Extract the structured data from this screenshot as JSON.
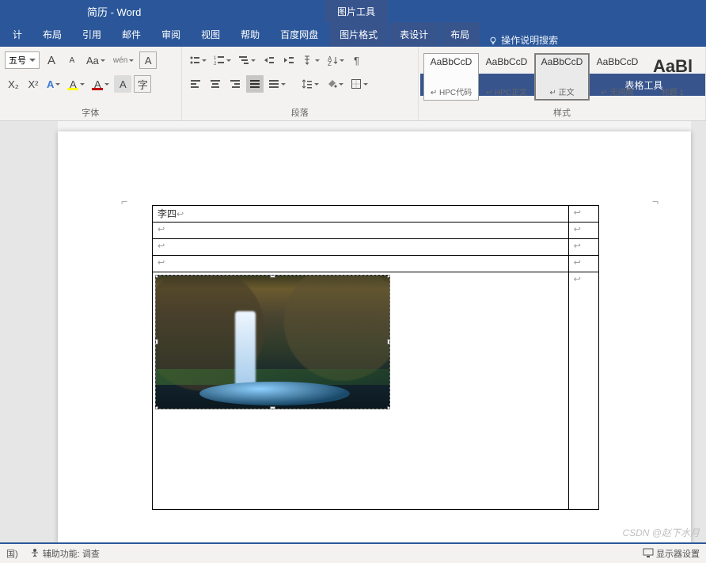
{
  "title": "简历 - Word",
  "contextual": {
    "picture": "图片工具",
    "table": "表格工具"
  },
  "menu": {
    "items": [
      "计",
      "布局",
      "引用",
      "邮件",
      "审阅",
      "视图",
      "帮助",
      "百度网盘"
    ],
    "ctx_items": [
      "图片格式",
      "表设计",
      "布局"
    ],
    "tell_me": "操作说明搜索"
  },
  "ribbon": {
    "font": {
      "size": "五号",
      "grow": "A",
      "shrink": "A",
      "case": "Aa",
      "phonetic": "wén",
      "charborder": "A",
      "sub": "X₂",
      "sup": "X²",
      "texteffects": "A",
      "highlight": "A",
      "fontcolor": "A",
      "charshade": "A",
      "enclose": "字",
      "highlight_color": "#ffff00",
      "fontcolor_color": "#c00000",
      "label": "字体"
    },
    "para": {
      "label": "段落"
    },
    "styles": {
      "label": "样式",
      "items": [
        {
          "preview": "AaBbCcD",
          "name": "HPC代码",
          "mark": "↵"
        },
        {
          "preview": "AaBbCcD",
          "name": "HPC正文",
          "mark": "↵"
        },
        {
          "preview": "AaBbCcD",
          "name": "正文",
          "mark": "↵",
          "selected": true
        },
        {
          "preview": "AaBbCcD",
          "name": "无间隔",
          "mark": "↵"
        },
        {
          "preview": "AaBl",
          "name": "标题 1",
          "big": true
        }
      ]
    }
  },
  "doc": {
    "cell_a1": "李四"
  },
  "status": {
    "left1": "国)",
    "acc_icon": "⚙",
    "acc": "辅助功能: 调查",
    "display": "显示器设置"
  },
  "watermark": "CSDN @赵下水月"
}
